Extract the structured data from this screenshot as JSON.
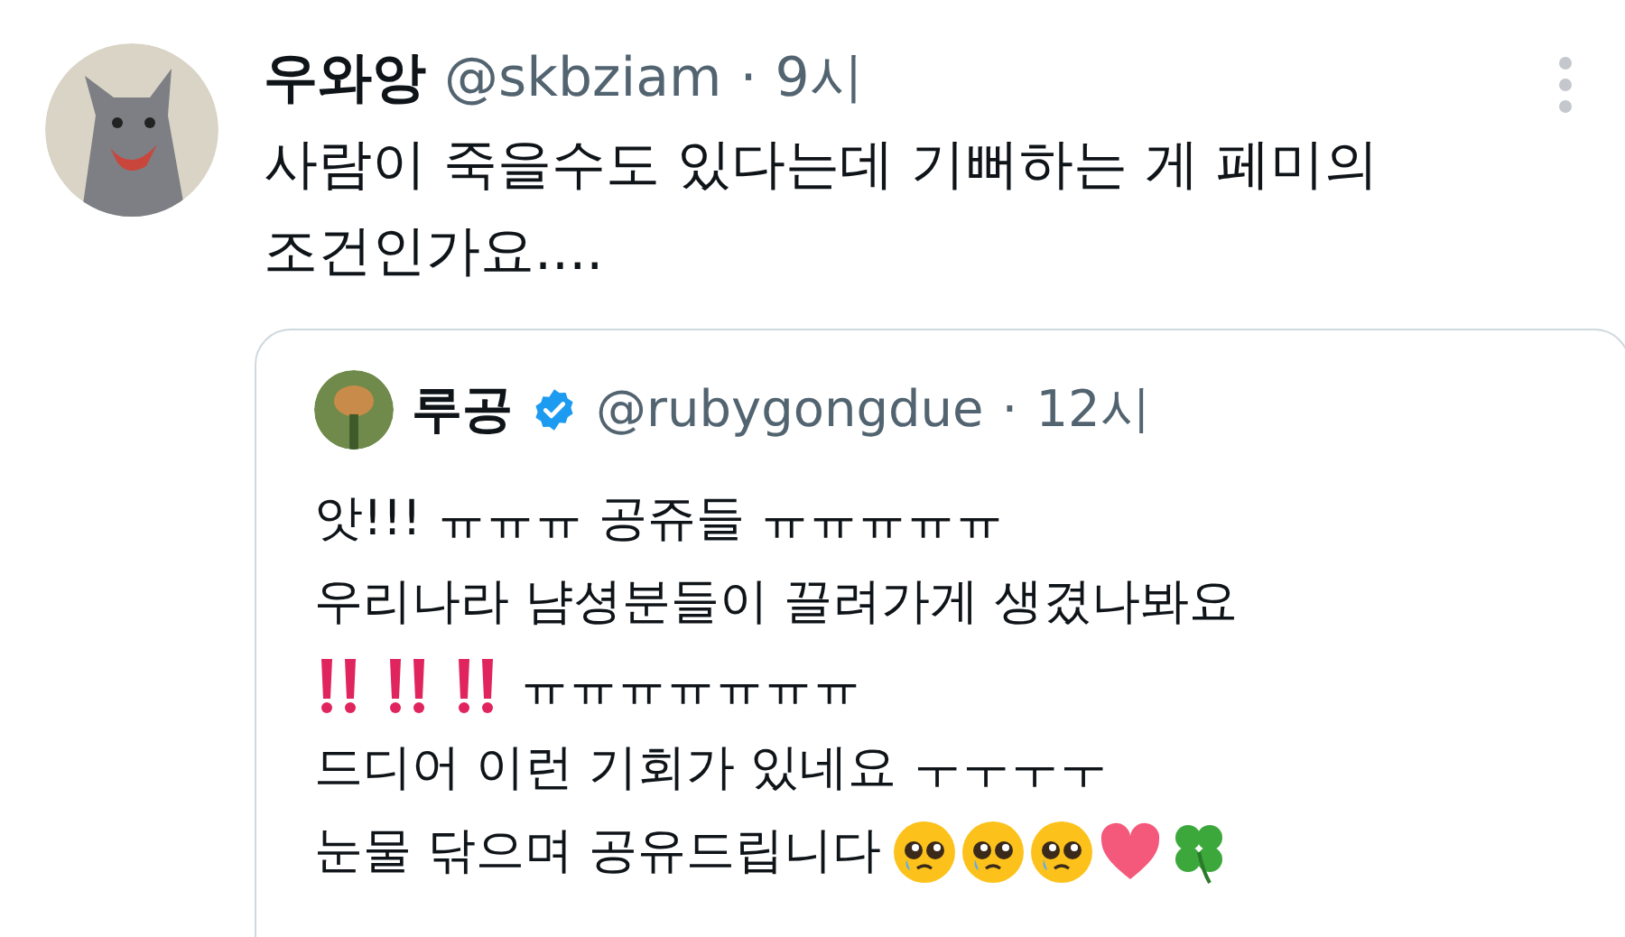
{
  "tweet": {
    "display_name": "우와앙",
    "handle": "@skbziam",
    "separator": "·",
    "time": "9시",
    "text": "사람이 죽을수도 있다는데 기뻐하는 게 페미의 조건인가요....",
    "quote": {
      "display_name": "루공",
      "verified": true,
      "handle": "@rubygongdue",
      "separator": "·",
      "time": "12시",
      "lines": [
        {
          "kind": "plain",
          "text": "앗!!! ㅠㅠㅠ 공쥬들 ㅠㅠㅠㅠㅠ"
        },
        {
          "kind": "plain",
          "text": "우리나라 냠셩분들이 끌려가게 생겼나봐요"
        },
        {
          "kind": "bangs-before",
          "text": "ㅠㅠㅠㅠㅠㅠㅠ"
        },
        {
          "kind": "plain",
          "text": "드디어 이런 기회가 있네요 ㅜㅜㅜㅜ"
        },
        {
          "kind": "emoji-after",
          "text": "눈물 닦으며 공유드립니다"
        }
      ]
    }
  }
}
